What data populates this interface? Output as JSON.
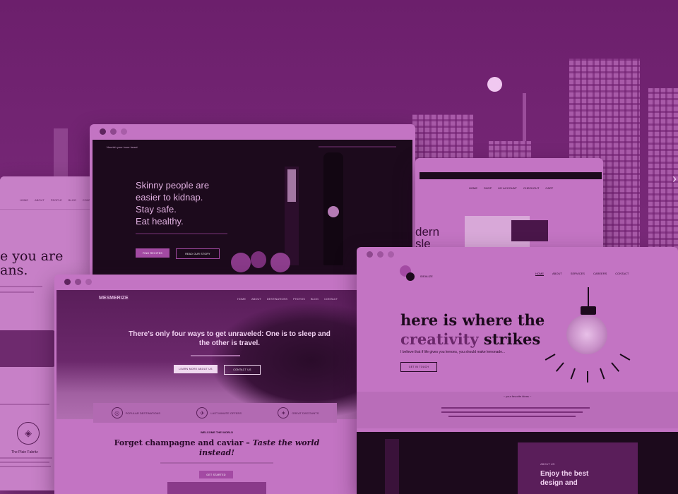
{
  "colors": {
    "background": "#7a2a7a",
    "window_frame": "#c374c3",
    "dark_panel": "#1c0a1c",
    "accent": "#d488d4"
  },
  "nav_arrow": "›",
  "left_card": {
    "nav": [
      "HOME",
      "ABOUT",
      "PEOPLE",
      "BLOG",
      "CONTACT"
    ],
    "hero_line1": "e you are",
    "hero_line2": "ans.",
    "feature_title": "The Plain Fabritz"
  },
  "health_card": {
    "brand": "Nourish your inner beast",
    "headline": [
      "Skinny people are",
      "easier to kidnap.",
      "Stay safe.",
      "Eat healthy."
    ],
    "button_primary": "FIND RECIPES",
    "button_secondary": "READ OUR STORY"
  },
  "shop_card": {
    "nav": [
      "HOME",
      "SHOP",
      "MY ACCOUNT",
      "CHECKOUT",
      "CART"
    ],
    "hero_partial_1": "dern",
    "hero_partial_2": "sle"
  },
  "travel_card": {
    "logo": "MESMERIZE",
    "nav": [
      "HOME",
      "ABOUT",
      "DESTINATIONS",
      "PHOTOS",
      "BLOG",
      "CONTACT"
    ],
    "headline": "There's only four ways to get unraveled: One is to sleep and the other is travel.",
    "button_primary": "LEARN MORE ABOUT US",
    "button_secondary": "CONTACT US",
    "features": [
      {
        "icon": "globe-icon",
        "title": "POPULAR DESTINATIONS"
      },
      {
        "icon": "plane-icon",
        "title": "LAST MINUTE OFFERS"
      },
      {
        "icon": "compass-icon",
        "title": "GREAT DISCOUNTS"
      }
    ],
    "section_label": "WELCOME THE WORLD",
    "section_heading_1": "Forget champagne and caviar –",
    "section_heading_italic": "Taste the world",
    "section_heading_2": "instead!",
    "cta": "GET STARTED"
  },
  "creative_card": {
    "logo": "IDEALIZE",
    "nav": [
      "HOME",
      "ABOUT",
      "SERVICES",
      "CAREERS",
      "CONTACT"
    ],
    "headline_1": "here is where the",
    "headline_accent": "creativity",
    "headline_2": "strikes",
    "subtext": "I believe that if life gives you lemons, you should make lemonade...",
    "button": "GET IN TOUCH",
    "quote_label": "~ your favorite ideas ~",
    "dark_label": "ABOUT US",
    "dark_heading_1": "Enjoy the best",
    "dark_heading_2": "design and"
  }
}
